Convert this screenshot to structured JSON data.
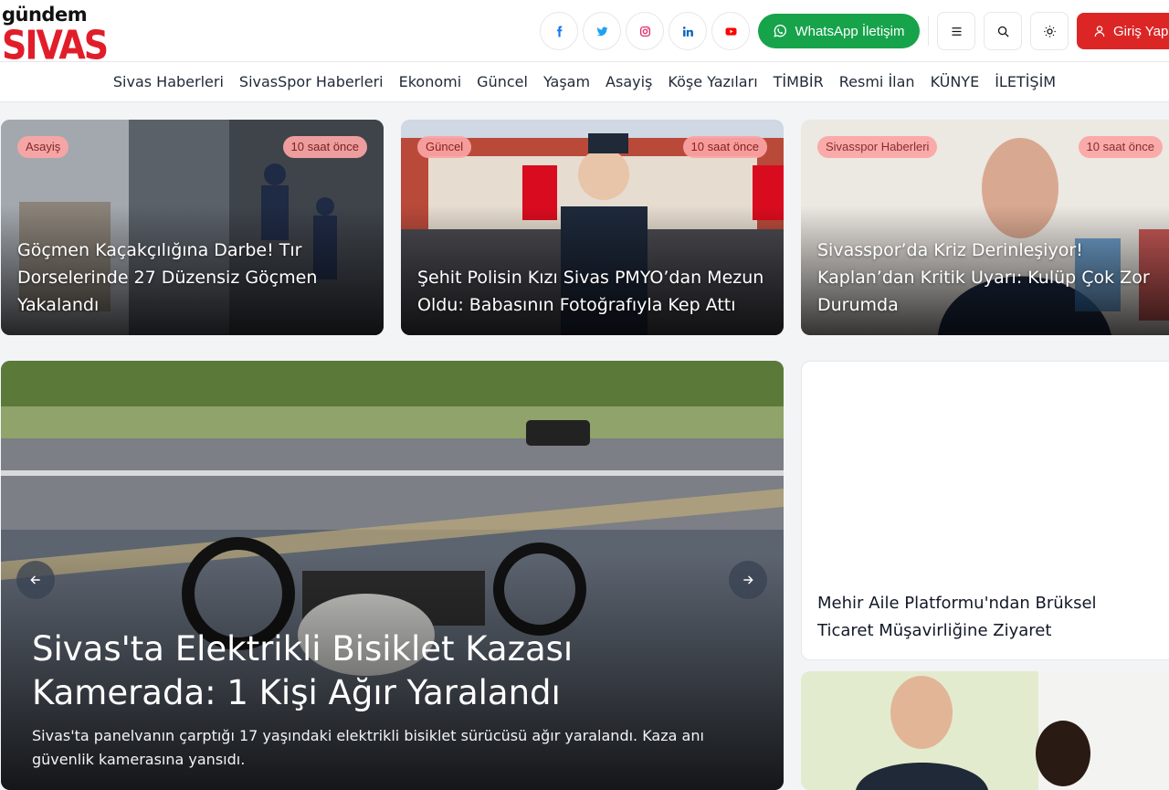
{
  "logo": {
    "top": "gündem",
    "bottom": "SIVAS"
  },
  "social": [
    "facebook-icon",
    "twitter-icon",
    "instagram-icon",
    "linkedin-icon",
    "youtube-icon"
  ],
  "header": {
    "whatsapp_label": "WhatsApp İletişim",
    "login_label": "Giriş Yap"
  },
  "nav": {
    "items": [
      "Sivas Haberleri",
      "SivasSpor Haberleri",
      "Ekonomi",
      "Güncel",
      "Yaşam",
      "Asayiş",
      "Köşe Yazıları",
      "TİMBİR",
      "Resmi İlan",
      "KÜNYE",
      "İLETİŞİM"
    ]
  },
  "top_cards": [
    {
      "category": "Asayiş",
      "time": "10 saat önce",
      "title": "Göçmen Kaçakçılığına Darbe! Tır Dorselerinde 27 Düzensiz Göçmen Yakalandı"
    },
    {
      "category": "Güncel",
      "time": "10 saat önce",
      "title": "Şehit Polisin Kızı Sivas PMYO’dan Mezun Oldu: Babasının Fotoğrafıyla Kep Attı"
    },
    {
      "category": "Sivasspor Haberleri",
      "time": "10 saat önce",
      "title": "Sivasspor’da Kriz Derinleşiyor! Kaplan’dan Kritik Uyarı: Kulüp Çok Zor Durumda"
    }
  ],
  "hero": {
    "title": "Sivas'ta Elektrikli Bisiklet Kazası Kamerada: 1 Kişi Ağır Yaralandı",
    "summary": "Sivas'ta panelvanın çarptığı 17 yaşındaki elektrikli bisiklet sürücüsü ağır yaralandı. Kaza anı güvenlik kamerasına yansıdı."
  },
  "side_card": {
    "title": "Mehir Aile Platformu'ndan Brüksel Ticaret Müşavirliğine Ziyaret"
  },
  "colors": {
    "brand_red": "#e11d2a",
    "whatsapp_green": "#16a34a",
    "badge_pink": "#fca5a5"
  }
}
